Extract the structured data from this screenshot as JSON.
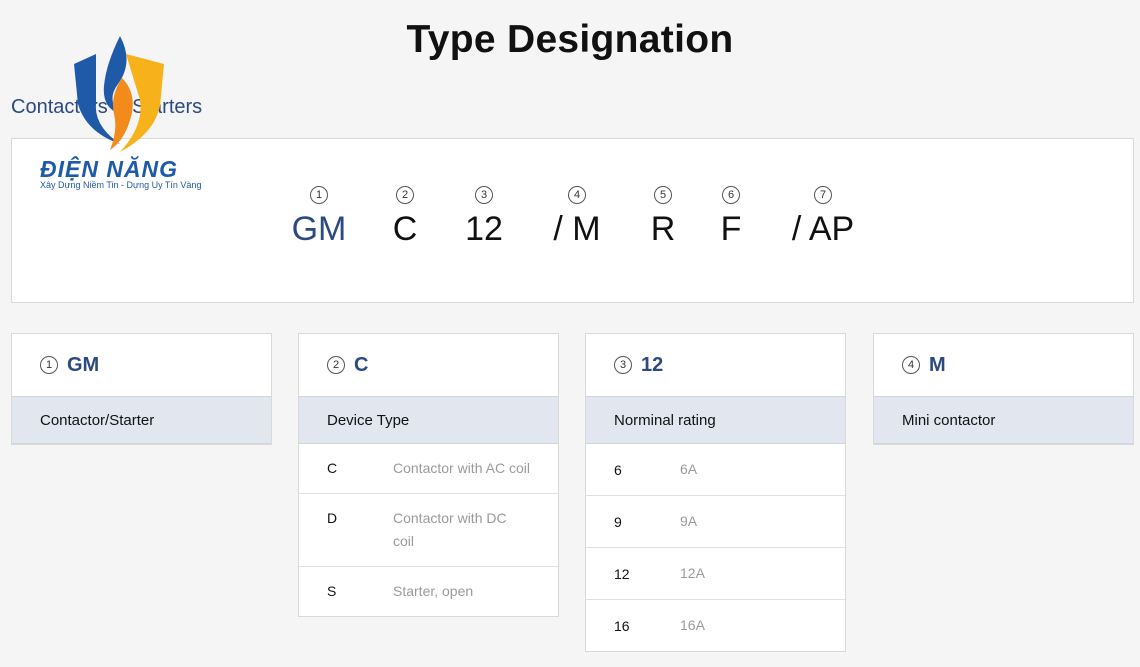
{
  "page": {
    "title": "Type Designation",
    "section": "Contactors & Starters"
  },
  "logo": {
    "brand": "ĐIỆN NĂNG",
    "tagline": "Xây Dựng Niềm Tin - Dựng Uy Tín Vàng"
  },
  "designation": [
    {
      "num": "1",
      "code": "GM"
    },
    {
      "num": "2",
      "code": "C"
    },
    {
      "num": "3",
      "code": "12"
    },
    {
      "num": "4",
      "code": "/ M"
    },
    {
      "num": "5",
      "code": "R"
    },
    {
      "num": "6",
      "code": "F"
    },
    {
      "num": "7",
      "code": "/ AP"
    }
  ],
  "cards": [
    {
      "num": "1",
      "code": "GM",
      "subtitle": "Contactor/Starter",
      "rows": []
    },
    {
      "num": "2",
      "code": "C",
      "subtitle": "Device Type",
      "rows": [
        {
          "key": "C",
          "value": "Contactor with AC coil"
        },
        {
          "key": "D",
          "value": "Contactor with DC coil"
        },
        {
          "key": "S",
          "value": "Starter, open"
        }
      ]
    },
    {
      "num": "3",
      "code": "12",
      "subtitle": "Norminal rating",
      "rows": [
        {
          "key": "6",
          "value": "6A"
        },
        {
          "key": "9",
          "value": "9A"
        },
        {
          "key": "12",
          "value": "12A"
        },
        {
          "key": "16",
          "value": "16A"
        }
      ]
    },
    {
      "num": "4",
      "code": "M",
      "subtitle": "Mini contactor",
      "rows": []
    }
  ],
  "colors": {
    "accent": "#2b4a7f",
    "subheader_bg": "#e1e6ef",
    "page_bg": "#f5f5f5"
  }
}
